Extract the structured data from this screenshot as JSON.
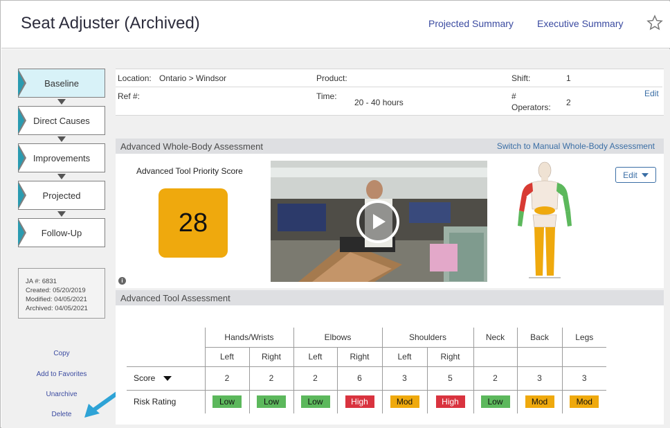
{
  "header": {
    "title": "Seat Adjuster (Archived)",
    "links": [
      "Projected Summary",
      "Executive Summary"
    ]
  },
  "steps": [
    "Baseline",
    "Direct Causes",
    "Improvements",
    "Projected",
    "Follow-Up"
  ],
  "active_step": "Baseline",
  "meta": {
    "ja": "JA #: 6831",
    "created": "Created: 05/20/2019",
    "modified": "Modified: 04/05/2021",
    "archived": "Archived: 04/05/2021"
  },
  "side_links": [
    "Copy",
    "Add to Favorites",
    "Unarchive",
    "Delete"
  ],
  "info": {
    "location_label": "Location:",
    "location_value": "Ontario > Windsor",
    "product_label": "Product:",
    "shift_label": "Shift:",
    "shift_value": "1",
    "ref_label": "Ref #:",
    "time_label": "Time:",
    "time_value": "20 - 40 hours",
    "operators_label_1": "#",
    "operators_label_2": "Operators:",
    "operators_value": "2",
    "edit": "Edit"
  },
  "whole_body": {
    "title": "Advanced Whole-Body Assessment",
    "switch_link": "Switch to Manual Whole-Body Assessment",
    "priority_label": "Advanced Tool Priority Score",
    "priority_score": "28",
    "info_icon": "i",
    "edit_button": "Edit"
  },
  "tool_assessment": {
    "title": "Advanced Tool Assessment",
    "groups": [
      "Hands/Wrists",
      "Elbows",
      "Shoulders",
      "Neck",
      "Back",
      "Legs"
    ],
    "sides": [
      "Left",
      "Right",
      "Left",
      "Right",
      "Left",
      "Right"
    ],
    "score_label": "Score",
    "rating_label": "Risk Rating",
    "scores": [
      "2",
      "2",
      "2",
      "6",
      "3",
      "5",
      "2",
      "3",
      "3"
    ],
    "ratings": [
      "Low",
      "Low",
      "Low",
      "High",
      "Mod",
      "High",
      "Low",
      "Mod",
      "Mod"
    ]
  },
  "colors": {
    "low": "#5cb85c",
    "mod": "#efa90d",
    "high": "#d9333f",
    "link": "#3a4aa0",
    "active_step": "#d8f2f8"
  }
}
